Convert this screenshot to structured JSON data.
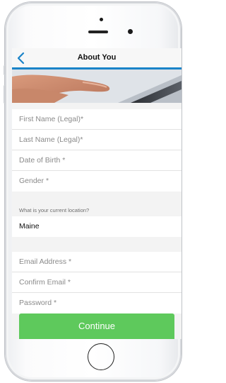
{
  "header": {
    "title": "About You",
    "back_icon": "chevron-left-icon"
  },
  "personal_fields": [
    {
      "placeholder": "First Name (Legal)*"
    },
    {
      "placeholder": "Last Name (Legal)*"
    },
    {
      "placeholder": "Date of Birth *"
    },
    {
      "placeholder": "Gender *"
    }
  ],
  "location": {
    "question": "What is your current location?",
    "value": "Maine"
  },
  "account_fields": [
    {
      "placeholder": "Email Address *"
    },
    {
      "placeholder": "Confirm Email *"
    },
    {
      "placeholder": "Password *"
    }
  ],
  "continue_button": {
    "label": "Continue"
  },
  "colors": {
    "accent_blue": "#1a83c8",
    "continue_green": "#5ec95c"
  }
}
